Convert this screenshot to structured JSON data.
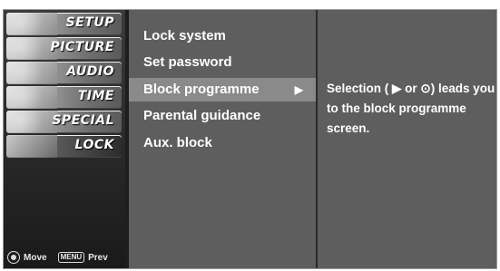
{
  "categories": [
    {
      "label": "SETUP",
      "active": false
    },
    {
      "label": "PICTURE",
      "active": false
    },
    {
      "label": "AUDIO",
      "active": false
    },
    {
      "label": "TIME",
      "active": false
    },
    {
      "label": "SPECIAL",
      "active": false
    },
    {
      "label": "LOCK",
      "active": true
    }
  ],
  "hint": {
    "move_label": "Move",
    "menu_key": "MENU",
    "prev_label": "Prev"
  },
  "menu": {
    "items": [
      {
        "label": "Lock system"
      },
      {
        "label": "Set password"
      },
      {
        "label": "Block programme",
        "selected": true,
        "arrow": "▶"
      },
      {
        "label": "Parental guidance"
      },
      {
        "label": "Aux. block"
      }
    ]
  },
  "description": "Selection ( ▶ or ⊙) leads you to the block programme screen."
}
